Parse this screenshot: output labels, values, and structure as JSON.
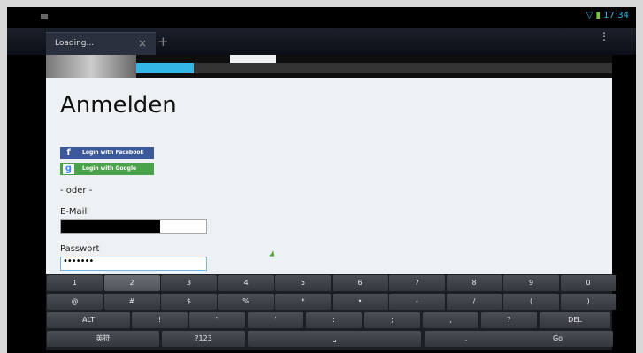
{
  "badge": "48",
  "status": {
    "time": "17:34"
  },
  "tab": {
    "title": "Loading...",
    "close": "×",
    "new": "+"
  },
  "menu_icon": "⋮",
  "progress": {
    "fraction": 0.12
  },
  "page": {
    "title": "Anmelden",
    "facebook_label": "Login with Facebook",
    "google_label": "Login with Google",
    "or": "- oder -",
    "email_label": "E-Mail",
    "password_label": "Passwort",
    "password_value": "•••••••"
  },
  "keyboard": {
    "row1": [
      "1",
      "2",
      "3",
      "4",
      "5",
      "6",
      "7",
      "8",
      "9",
      "0"
    ],
    "row2": [
      "@",
      "#",
      "$",
      "%",
      "*",
      "•",
      "-",
      "/",
      "(",
      ")"
    ],
    "row3": [
      "ALT",
      "!",
      "\"",
      "'",
      ":",
      ";",
      ",",
      "?",
      "DEL"
    ],
    "row4": [
      "英符",
      "?123",
      "␣",
      ".",
      "Go"
    ]
  }
}
